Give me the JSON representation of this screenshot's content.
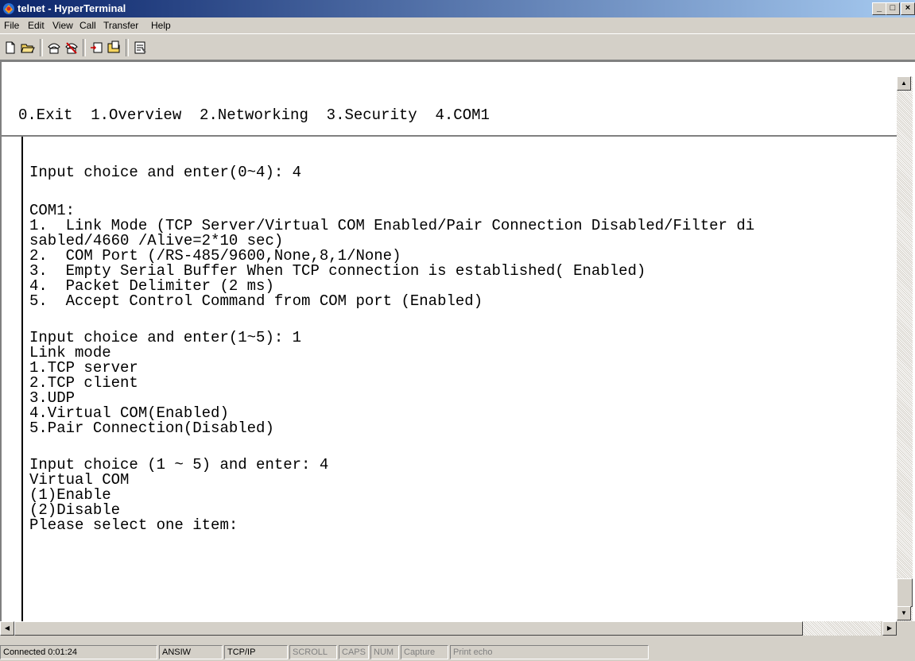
{
  "window": {
    "title": "telnet - HyperTerminal",
    "controls": [
      "_",
      "□",
      "×"
    ]
  },
  "menu": [
    "File",
    "Edit",
    "View",
    "Call",
    "Transfer",
    "Help"
  ],
  "toolbar": {
    "buttons": [
      "new-icon",
      "open-icon",
      "connect-icon",
      "disconnect-icon",
      "send-icon",
      "receive-icon",
      "properties-icon"
    ]
  },
  "terminal": {
    "lines": [
      "0.Exit  1.Overview  2.Networking  3.Security  4.COM1",
      "Input choice and enter(0~4): 4",
      "COM1:",
      "1.  Link Mode (TCP Server/Virtual COM Enabled/Pair Connection Disabled/Filter di",
      "sabled/4660 /Alive=2*10 sec)",
      "2.  COM Port (/RS-485/9600,None,8,1/None)",
      "3.  Empty Serial Buffer When TCP connection is established( Enabled)",
      "4.  Packet Delimiter (2 ms)",
      "5.  Accept Control Command from COM port (Enabled)",
      "Input choice and enter(1~5): 1",
      "Link mode",
      "1.TCP server",
      "2.TCP client",
      "3.UDP",
      "4.Virtual COM(Enabled)",
      "5.Pair Connection(Disabled)",
      "Input choice (1 ~ 5) and enter: 4",
      "Virtual COM",
      "(1)Enable",
      "(2)Disable",
      "Please select one item:"
    ]
  },
  "status": {
    "connected": "Connected 0:01:24",
    "emulation": "ANSIW",
    "protocol": "TCP/IP",
    "scroll": "SCROLL",
    "caps": "CAPS",
    "num": "NUM",
    "capture": "Capture",
    "print_echo": "Print echo"
  },
  "colors": {
    "titlebar_start": "#0a246a",
    "titlebar_end": "#a6caf0",
    "face": "#d4d0c8",
    "terminal_bg": "#ffffff"
  }
}
